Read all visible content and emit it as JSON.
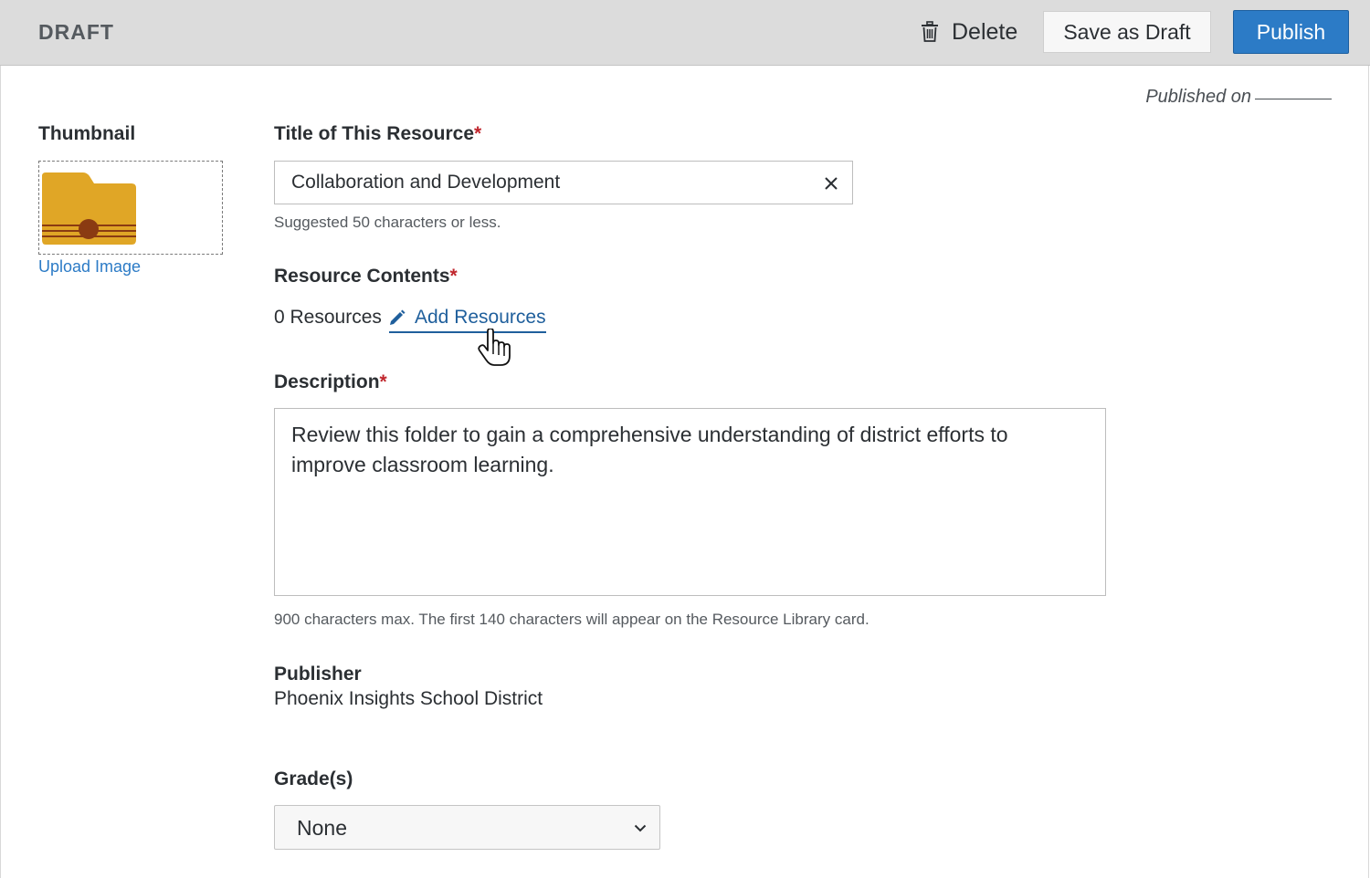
{
  "header": {
    "status": "DRAFT",
    "delete_label": "Delete",
    "save_draft_label": "Save as Draft",
    "publish_label": "Publish"
  },
  "meta": {
    "published_on_label": "Published on"
  },
  "thumbnail": {
    "label": "Thumbnail",
    "upload_label": "Upload Image",
    "icon": "folder-icon"
  },
  "form": {
    "title": {
      "label": "Title of This Resource",
      "required_mark": "*",
      "value": "Collaboration and Development",
      "hint": "Suggested 50 characters or less."
    },
    "contents": {
      "label": "Resource Contents",
      "required_mark": "*",
      "count_text": "0 Resources",
      "add_label": "Add Resources"
    },
    "description": {
      "label": "Description",
      "required_mark": "*",
      "value": "Review this folder to gain a comprehensive understanding of district efforts to improve classroom learning.",
      "hint": "900 characters max. The first 140 characters will appear on the Resource Library card."
    },
    "publisher": {
      "label": "Publisher",
      "value": "Phoenix Insights School District"
    },
    "grades": {
      "label": "Grade(s)",
      "selected": "None"
    }
  },
  "colors": {
    "accent": "#2c7bc6",
    "required": "#c0262d",
    "folder": "#e0a626"
  }
}
